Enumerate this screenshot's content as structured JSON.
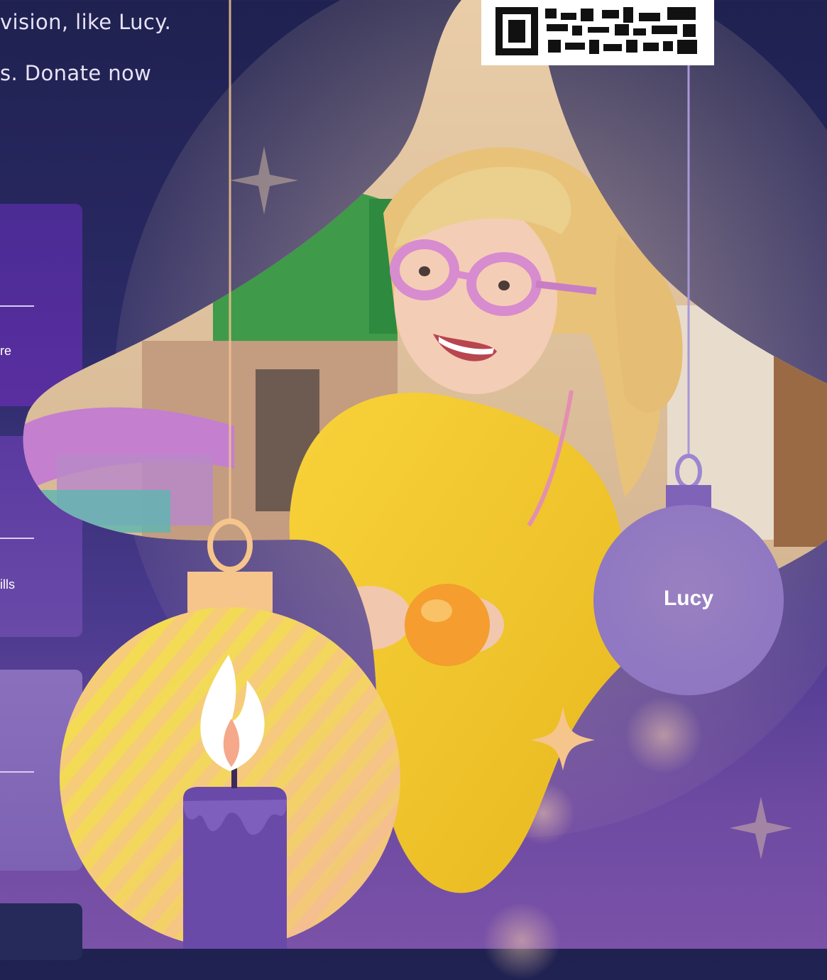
{
  "intro": {
    "line1": "vision, like Lucy.",
    "line2": "s. Donate now"
  },
  "panels": [
    {
      "text": "re"
    },
    {
      "text": "ills"
    },
    {
      "text": ""
    },
    {
      "text": ""
    }
  ],
  "ornament": {
    "name_label": "Lucy"
  },
  "colors": {
    "background_top": "#1f2150",
    "background_bottom": "#7a52a8",
    "panel_purple": "#5a2e9e",
    "ornament_lavender": "#8e76c2",
    "ornament_gold": "#f3d44a",
    "candle_purple": "#6a4aa8",
    "accent_peach": "#f6c58b"
  },
  "icons": [
    "qr-code-icon",
    "sparkle-icon",
    "candle-icon",
    "flame-icon",
    "ornament-icon"
  ]
}
